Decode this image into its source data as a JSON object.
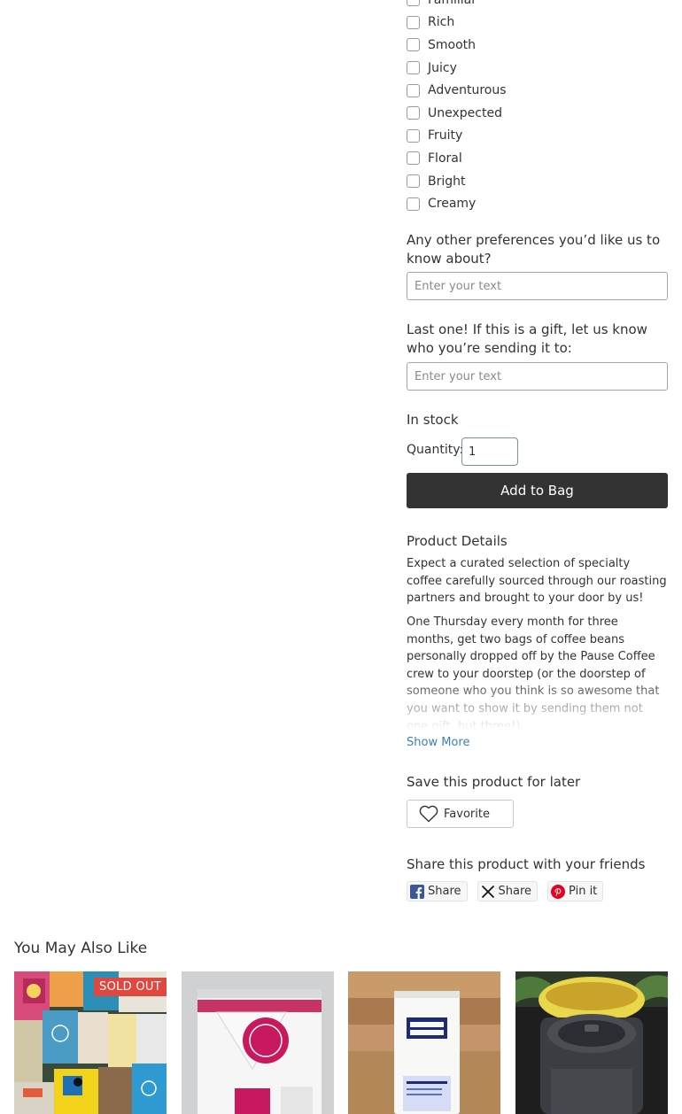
{
  "flavor_options": [
    "Familiar",
    "Rich",
    "Smooth",
    "Juicy",
    "Adventurous",
    "Unexpected",
    "Fruity",
    "Floral",
    "Bright",
    "Creamy"
  ],
  "preferences": {
    "label": "Any other preferences you’d like us to know about?",
    "placeholder": "Enter your text"
  },
  "gift": {
    "label": "Last one! If this is a gift, let us know who you’re sending it to:",
    "placeholder": "Enter your text"
  },
  "stock_status": "In stock",
  "quantity": {
    "label": "Quantity:",
    "value": "1"
  },
  "add_to_bag": "Add to Bag",
  "product_details": {
    "title": "Product Details",
    "paragraph1": "Expect a curated selection of specialty coffee carefully sourced through our roasting partners and brought to your door by us!",
    "paragraph2": "One Thursday every month for three months, get two bags of coffee beans personally dropped off by the Pause Coffee crew to your doorstep (or the doorstep of someone who you think is so awesome that you want to show it by sending them not one gift, but three!)."
  },
  "show_more": "Show More",
  "save_for_later": {
    "title": "Save this product for later",
    "button": "Favorite"
  },
  "share": {
    "title": "Share this product with your friends",
    "facebook": "Share",
    "x": "Share",
    "pinterest": "Pin it"
  },
  "you_may_also_like": {
    "title": "You May Also Like",
    "sold_out_badge": "SOLD OUT"
  },
  "colors": {
    "button_dark": "#333333",
    "link_blue": "#3f7fb5",
    "sold_out_red": "#e0473e",
    "facebook_blue": "#3b5998",
    "pinterest_red": "#e60023"
  }
}
